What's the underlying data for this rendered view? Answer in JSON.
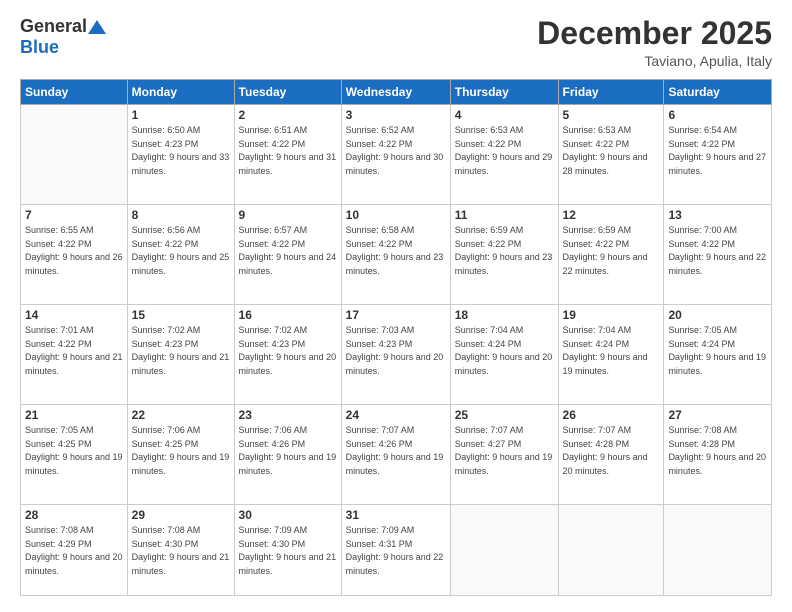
{
  "logo": {
    "general": "General",
    "blue": "Blue"
  },
  "title": "December 2025",
  "subtitle": "Taviano, Apulia, Italy",
  "weekdays": [
    "Sunday",
    "Monday",
    "Tuesday",
    "Wednesday",
    "Thursday",
    "Friday",
    "Saturday"
  ],
  "weeks": [
    [
      {
        "day": "",
        "sunrise": "",
        "sunset": "",
        "daylight": ""
      },
      {
        "day": "1",
        "sunrise": "Sunrise: 6:50 AM",
        "sunset": "Sunset: 4:23 PM",
        "daylight": "Daylight: 9 hours and 33 minutes."
      },
      {
        "day": "2",
        "sunrise": "Sunrise: 6:51 AM",
        "sunset": "Sunset: 4:22 PM",
        "daylight": "Daylight: 9 hours and 31 minutes."
      },
      {
        "day": "3",
        "sunrise": "Sunrise: 6:52 AM",
        "sunset": "Sunset: 4:22 PM",
        "daylight": "Daylight: 9 hours and 30 minutes."
      },
      {
        "day": "4",
        "sunrise": "Sunrise: 6:53 AM",
        "sunset": "Sunset: 4:22 PM",
        "daylight": "Daylight: 9 hours and 29 minutes."
      },
      {
        "day": "5",
        "sunrise": "Sunrise: 6:53 AM",
        "sunset": "Sunset: 4:22 PM",
        "daylight": "Daylight: 9 hours and 28 minutes."
      },
      {
        "day": "6",
        "sunrise": "Sunrise: 6:54 AM",
        "sunset": "Sunset: 4:22 PM",
        "daylight": "Daylight: 9 hours and 27 minutes."
      }
    ],
    [
      {
        "day": "7",
        "sunrise": "Sunrise: 6:55 AM",
        "sunset": "Sunset: 4:22 PM",
        "daylight": "Daylight: 9 hours and 26 minutes."
      },
      {
        "day": "8",
        "sunrise": "Sunrise: 6:56 AM",
        "sunset": "Sunset: 4:22 PM",
        "daylight": "Daylight: 9 hours and 25 minutes."
      },
      {
        "day": "9",
        "sunrise": "Sunrise: 6:57 AM",
        "sunset": "Sunset: 4:22 PM",
        "daylight": "Daylight: 9 hours and 24 minutes."
      },
      {
        "day": "10",
        "sunrise": "Sunrise: 6:58 AM",
        "sunset": "Sunset: 4:22 PM",
        "daylight": "Daylight: 9 hours and 23 minutes."
      },
      {
        "day": "11",
        "sunrise": "Sunrise: 6:59 AM",
        "sunset": "Sunset: 4:22 PM",
        "daylight": "Daylight: 9 hours and 23 minutes."
      },
      {
        "day": "12",
        "sunrise": "Sunrise: 6:59 AM",
        "sunset": "Sunset: 4:22 PM",
        "daylight": "Daylight: 9 hours and 22 minutes."
      },
      {
        "day": "13",
        "sunrise": "Sunrise: 7:00 AM",
        "sunset": "Sunset: 4:22 PM",
        "daylight": "Daylight: 9 hours and 22 minutes."
      }
    ],
    [
      {
        "day": "14",
        "sunrise": "Sunrise: 7:01 AM",
        "sunset": "Sunset: 4:22 PM",
        "daylight": "Daylight: 9 hours and 21 minutes."
      },
      {
        "day": "15",
        "sunrise": "Sunrise: 7:02 AM",
        "sunset": "Sunset: 4:23 PM",
        "daylight": "Daylight: 9 hours and 21 minutes."
      },
      {
        "day": "16",
        "sunrise": "Sunrise: 7:02 AM",
        "sunset": "Sunset: 4:23 PM",
        "daylight": "Daylight: 9 hours and 20 minutes."
      },
      {
        "day": "17",
        "sunrise": "Sunrise: 7:03 AM",
        "sunset": "Sunset: 4:23 PM",
        "daylight": "Daylight: 9 hours and 20 minutes."
      },
      {
        "day": "18",
        "sunrise": "Sunrise: 7:04 AM",
        "sunset": "Sunset: 4:24 PM",
        "daylight": "Daylight: 9 hours and 20 minutes."
      },
      {
        "day": "19",
        "sunrise": "Sunrise: 7:04 AM",
        "sunset": "Sunset: 4:24 PM",
        "daylight": "Daylight: 9 hours and 19 minutes."
      },
      {
        "day": "20",
        "sunrise": "Sunrise: 7:05 AM",
        "sunset": "Sunset: 4:24 PM",
        "daylight": "Daylight: 9 hours and 19 minutes."
      }
    ],
    [
      {
        "day": "21",
        "sunrise": "Sunrise: 7:05 AM",
        "sunset": "Sunset: 4:25 PM",
        "daylight": "Daylight: 9 hours and 19 minutes."
      },
      {
        "day": "22",
        "sunrise": "Sunrise: 7:06 AM",
        "sunset": "Sunset: 4:25 PM",
        "daylight": "Daylight: 9 hours and 19 minutes."
      },
      {
        "day": "23",
        "sunrise": "Sunrise: 7:06 AM",
        "sunset": "Sunset: 4:26 PM",
        "daylight": "Daylight: 9 hours and 19 minutes."
      },
      {
        "day": "24",
        "sunrise": "Sunrise: 7:07 AM",
        "sunset": "Sunset: 4:26 PM",
        "daylight": "Daylight: 9 hours and 19 minutes."
      },
      {
        "day": "25",
        "sunrise": "Sunrise: 7:07 AM",
        "sunset": "Sunset: 4:27 PM",
        "daylight": "Daylight: 9 hours and 19 minutes."
      },
      {
        "day": "26",
        "sunrise": "Sunrise: 7:07 AM",
        "sunset": "Sunset: 4:28 PM",
        "daylight": "Daylight: 9 hours and 20 minutes."
      },
      {
        "day": "27",
        "sunrise": "Sunrise: 7:08 AM",
        "sunset": "Sunset: 4:28 PM",
        "daylight": "Daylight: 9 hours and 20 minutes."
      }
    ],
    [
      {
        "day": "28",
        "sunrise": "Sunrise: 7:08 AM",
        "sunset": "Sunset: 4:29 PM",
        "daylight": "Daylight: 9 hours and 20 minutes."
      },
      {
        "day": "29",
        "sunrise": "Sunrise: 7:08 AM",
        "sunset": "Sunset: 4:30 PM",
        "daylight": "Daylight: 9 hours and 21 minutes."
      },
      {
        "day": "30",
        "sunrise": "Sunrise: 7:09 AM",
        "sunset": "Sunset: 4:30 PM",
        "daylight": "Daylight: 9 hours and 21 minutes."
      },
      {
        "day": "31",
        "sunrise": "Sunrise: 7:09 AM",
        "sunset": "Sunset: 4:31 PM",
        "daylight": "Daylight: 9 hours and 22 minutes."
      },
      {
        "day": "",
        "sunrise": "",
        "sunset": "",
        "daylight": ""
      },
      {
        "day": "",
        "sunrise": "",
        "sunset": "",
        "daylight": ""
      },
      {
        "day": "",
        "sunrise": "",
        "sunset": "",
        "daylight": ""
      }
    ]
  ]
}
